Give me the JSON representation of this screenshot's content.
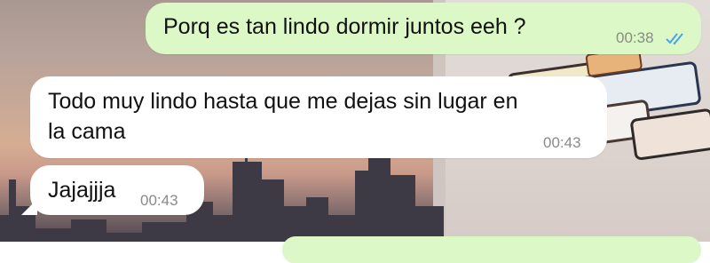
{
  "chat": {
    "messages": [
      {
        "direction": "outgoing",
        "text": "Porq es tan lindo dormir juntos eeh ?",
        "time": "00:38",
        "status": "read"
      },
      {
        "direction": "incoming",
        "text": "Todo muy lindo hasta que me dejas sin lugar en\nla cama",
        "time": "00:43"
      },
      {
        "direction": "incoming",
        "text": "Jajajjja",
        "time": "00:43"
      }
    ]
  },
  "colors": {
    "outgoing_bubble": "#dcf8c6",
    "incoming_bubble": "#ffffff",
    "read_ticks": "#4fa3e0",
    "timestamp": "#8a8a8a"
  },
  "icons": {
    "read_receipt": "double-check-icon"
  }
}
